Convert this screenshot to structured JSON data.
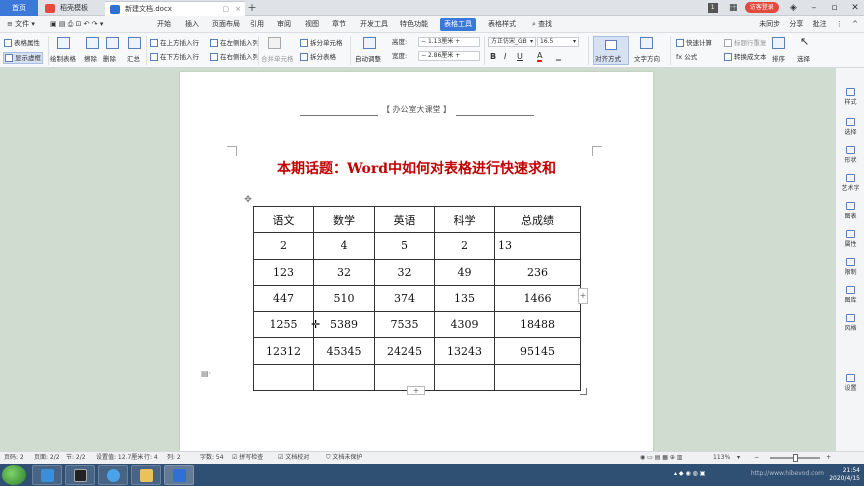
{
  "titlebar": {
    "home_tab": "首页",
    "tabs": [
      {
        "label": "稻壳模板",
        "color": "#e8493f",
        "active": false
      },
      {
        "label": "新建文档.docx",
        "color": "#2f6fd6",
        "active": true
      }
    ],
    "plus": "+",
    "badge_num": "1",
    "login": "访客登录"
  },
  "menubar": {
    "file": "文件",
    "items": [
      "开始",
      "插入",
      "页面布局",
      "引用",
      "审阅",
      "视图",
      "章节",
      "开发工具",
      "特色功能"
    ],
    "tools_tab": "表格工具",
    "style_tab": "表格样式",
    "search": "查找",
    "right": [
      "未同步",
      "分享",
      "批注"
    ]
  },
  "ribbon": {
    "props": "表格属性",
    "gridlines": "显示虚框",
    "draw": "绘制表格",
    "erase": "擦除",
    "delete": "删除",
    "summary": "汇总",
    "insert_above": "在上方插入行",
    "insert_below": "在下方插入行",
    "insert_left": "在左侧插入列",
    "insert_right": "在右侧插入列",
    "merge": "合并单元格",
    "split_cell": "拆分单元格",
    "split_table": "拆分表格",
    "autofit": "自动调整",
    "height_label": "高度:",
    "height_value": "1.13厘米",
    "width_label": "宽度:",
    "width_value": "2.86厘米",
    "font_name": "方正仿宋_GB",
    "font_size": "16.5",
    "bold": "B",
    "italic": "I",
    "underline": "U",
    "font_color": "A",
    "align": "对齐方式",
    "text_dir": "文字方向",
    "quick_calc": "快速计算",
    "title_repeat": "标题行重复",
    "formula": "fx 公式",
    "to_text": "转换成文本",
    "sort": "排序",
    "select": "选择"
  },
  "document": {
    "header": "【 办公室大课堂 】",
    "title": "本期话题：Word中如何对表格进行快速求和",
    "table": {
      "headers": [
        "语文",
        "数学",
        "英语",
        "科学",
        "总成绩"
      ],
      "rows": [
        [
          "2",
          "4",
          "5",
          "2",
          "13"
        ],
        [
          "123",
          "32",
          "32",
          "49",
          "236"
        ],
        [
          "447",
          "510",
          "374",
          "135",
          "1466"
        ],
        [
          "1255",
          "5389",
          "7535",
          "4309",
          "18488"
        ],
        [
          "12312",
          "45345",
          "24245",
          "13243",
          "95145"
        ],
        [
          "",
          "",
          "",
          "",
          ""
        ]
      ]
    }
  },
  "sidebar": {
    "items": [
      "样式",
      "选择",
      "形状",
      "艺术字",
      "图表",
      "属性",
      "限制",
      "图库",
      "风格",
      "设置"
    ]
  },
  "statusbar": {
    "page_num": "页码: 2",
    "pages": "页面: 2/2",
    "section": "节: 2/2",
    "setting": "设置值: 12.7厘米",
    "row": "行: 4",
    "col": "列: 2",
    "words": "字数: 54",
    "spell": "拼写检查",
    "proofread": "文档校对",
    "protect": "文档未保护",
    "zoom": "113%"
  },
  "taskbar": {
    "time": "21:54",
    "date": "2020/4/15",
    "watermark": "http://www.hibevod.com"
  },
  "colors": {
    "accent": "#3b78d8",
    "title_red": "#c00000",
    "workspace": "#cfdccf",
    "taskbar": "#2f4f73"
  }
}
